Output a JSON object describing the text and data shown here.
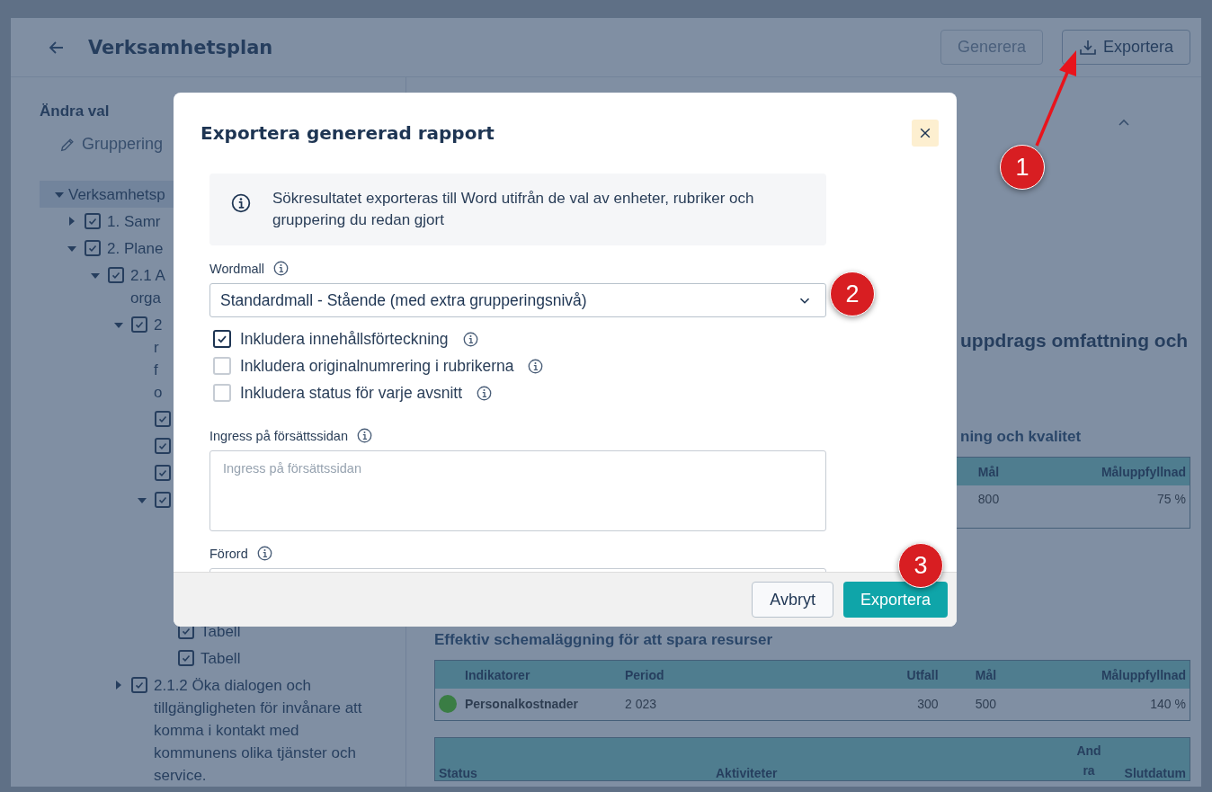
{
  "header": {
    "title": "Verksamhetsplan",
    "buttons": [
      {
        "label": "Generera",
        "disabled": true,
        "kind": "plain"
      },
      {
        "label": "Exportera",
        "disabled": false,
        "kind": "download"
      }
    ]
  },
  "sidebar": {
    "heading": "Ändra val",
    "edit_link": "Gruppering",
    "tree": [
      {
        "label": "Verksamhetsp",
        "expanded": true,
        "selected": true,
        "children": [
          {
            "label": "1. Samr",
            "expanded": false,
            "checked": true
          },
          {
            "label": "2. Plane",
            "expanded": true,
            "checked": true,
            "children": [
              {
                "label": "2.1 A\norga",
                "expanded": true,
                "checked": true,
                "children": [
                  {
                    "label": "2\nr\nf\no",
                    "expanded": true,
                    "checked": true,
                    "children": [
                      {
                        "checked": true
                      },
                      {
                        "checked": true
                      },
                      {
                        "checked": true
                      },
                      {
                        "expanded": true,
                        "checked": true,
                        "children": [
                          {
                            "label": "Tabell",
                            "checked": true
                          },
                          {
                            "label": "Tabell",
                            "checked": true
                          }
                        ]
                      }
                    ]
                  },
                  {
                    "label": "2.1.2 Öka dialogen och tillgängligheten för invånare att komma i kontakt med kommunens olika tjänster och service.",
                    "expanded": false,
                    "checked": true
                  }
                ]
              }
            ]
          }
        ]
      }
    ]
  },
  "main": {
    "heading": "uppdrags omfattning och",
    "sections": [
      {
        "title": "ning och kvalitet",
        "columns": [
          "Mål",
          "Måluppfyllnad"
        ],
        "rows": [
          {
            "cells": [
              "800",
              "75 %"
            ]
          }
        ]
      },
      {
        "title": "Effektiv schemaläggning för att spara resurser",
        "columns": [
          "Indikatorer",
          "Period",
          "Utfall",
          "Mål",
          "Måluppfyllnad"
        ],
        "rows": [
          {
            "color": "#3a7d44",
            "cells": [
              "Personalkostnader",
              "2 023",
              "300",
              "500",
              "140 %"
            ]
          }
        ]
      },
      {
        "kind": "activities",
        "columns": [
          "Status",
          "Aktiviteter",
          "Andra",
          "Slutdatum"
        ]
      }
    ]
  },
  "dialog": {
    "title": "Exportera genererad rapport",
    "info": "Sökresultatet exporteras till Word utifrån de val av enheter, rubriker och gruppering du redan gjort",
    "template_label": "Wordmall",
    "template_value": "Standardmall - Stående (med extra grupperingsnivå)",
    "options": [
      {
        "label": "Inkludera innehållsförteckning",
        "checked": true
      },
      {
        "label": "Inkludera originalnumrering i rubrikerna",
        "checked": false
      },
      {
        "label": "Inkludera status för varje avsnitt",
        "checked": false
      }
    ],
    "ingress_label": "Ingress på försättssidan",
    "ingress_placeholder": "Ingress på försättssidan",
    "foreword_label": "Förord",
    "buttons": [
      {
        "label": "Avbryt",
        "kind": "secondary"
      },
      {
        "label": "Exportera",
        "kind": "primary"
      }
    ]
  },
  "callouts": [
    "1",
    "2",
    "3"
  ]
}
